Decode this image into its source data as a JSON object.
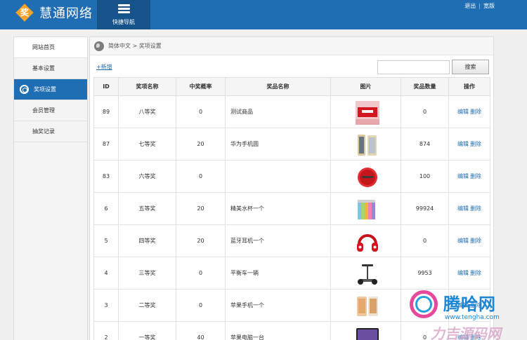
{
  "header": {
    "logo_char": "奖",
    "logo_text": "慧通网络",
    "quicknav_label": "快捷导航",
    "links": [
      "退出",
      "宽版"
    ]
  },
  "sidebar": {
    "items": [
      {
        "label": "网站首页"
      },
      {
        "label": "基本设置"
      },
      {
        "label": "奖项设置"
      },
      {
        "label": "会员管理"
      },
      {
        "label": "抽奖记录"
      }
    ]
  },
  "breadcrumb": "简体中文 > 奖项设置",
  "toolbar": {
    "add_label": "+新增",
    "search_value": "",
    "search_label": "搜索"
  },
  "table": {
    "headers": [
      "ID",
      "奖项名称",
      "中奖概率",
      "奖品名称",
      "图片",
      "奖品数量",
      "操作"
    ],
    "edit_label": "编辑",
    "delete_label": "删除",
    "rows": [
      {
        "id": "89",
        "level": "八等奖",
        "prob": "0",
        "prize": "测试商品",
        "image": "red-box",
        "qty": "0"
      },
      {
        "id": "87",
        "level": "七等奖",
        "prob": "20",
        "prize": "华为手机圆",
        "image": "phone-gold",
        "qty": "874"
      },
      {
        "id": "83",
        "level": "六等奖",
        "prob": "0",
        "prize": "",
        "image": "red-cleaner",
        "qty": "100"
      },
      {
        "id": "6",
        "level": "五等奖",
        "prob": "20",
        "prize": "精美水杯一个",
        "image": "cups",
        "qty": "99924"
      },
      {
        "id": "5",
        "level": "四等奖",
        "prob": "20",
        "prize": "蓝牙耳机一个",
        "image": "headphones",
        "qty": "0"
      },
      {
        "id": "4",
        "level": "三等奖",
        "prob": "0",
        "prize": "平衡车一辆",
        "image": "balance-scooter",
        "qty": "9953"
      },
      {
        "id": "3",
        "level": "二等奖",
        "prob": "0",
        "prize": "苹果手机一个",
        "image": "iphone",
        "qty": ""
      },
      {
        "id": "2",
        "level": "一等奖",
        "prob": "40",
        "prize": "苹果电脑一台",
        "image": "imac",
        "qty": "0"
      }
    ]
  },
  "watermark": {
    "title": "腾哈网",
    "sub": "www.tengha.com",
    "sub2": "力吉源码网"
  }
}
